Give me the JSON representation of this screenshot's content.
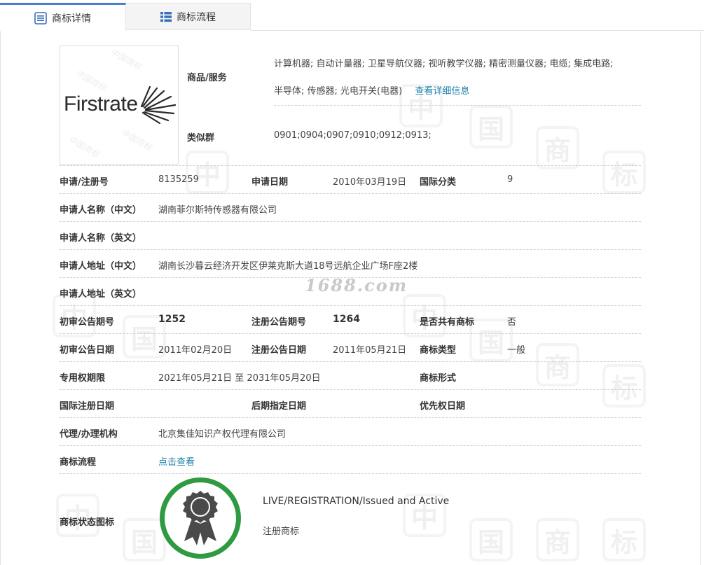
{
  "tabs": [
    {
      "label": "商标详情",
      "icon": "list-icon"
    },
    {
      "label": "商标流程",
      "icon": "grid-list-icon"
    }
  ],
  "logo": {
    "text": "Firstrate"
  },
  "watermark": {
    "char_a": "中",
    "char_b": "国",
    "char_c": "商",
    "char_d": "标",
    "site": "1688.com"
  },
  "goods": {
    "label": "商品/服务",
    "line1": "计算机器; 自动计量器; 卫星导航仪器; 视听教学仪器; 精密测量仪器; 电缆; 集成电路;",
    "line2": "半导体; 传感器; 光电开关(电器)",
    "detail_link": "查看详细信息"
  },
  "similar": {
    "label": "类似群",
    "value": "0901;0904;0907;0910;0912;0913;"
  },
  "rows": {
    "reg_no_label": "申请/注册号",
    "reg_no": "8135259",
    "apply_date_label": "申请日期",
    "apply_date": "2010年03月19日",
    "intl_class_label": "国际分类",
    "intl_class": "9",
    "applicant_cn_label": "申请人名称（中文）",
    "applicant_cn": "湖南菲尔斯特传感器有限公司",
    "applicant_en_label": "申请人名称（英文）",
    "applicant_en": "",
    "address_cn_label": "申请人地址（中文）",
    "address_cn": "湖南长沙暮云经济开发区伊莱克斯大道18号远航企业广场F座2楼",
    "address_en_label": "申请人地址（英文）",
    "address_en": "",
    "prelim_no_label": "初审公告期号",
    "prelim_no": "1252",
    "reg_pub_no_label": "注册公告期号",
    "reg_pub_no": "1264",
    "shared_label": "是否共有商标",
    "shared": "否",
    "prelim_date_label": "初审公告日期",
    "prelim_date": "2011年02月20日",
    "reg_pub_date_label": "注册公告日期",
    "reg_pub_date": "2011年05月21日",
    "type_label": "商标类型",
    "type": "一般",
    "term_label": "专用权期限",
    "term": "2021年05月21日 至 2031年05月20日",
    "form_label": "商标形式",
    "form": "",
    "intl_reg_date_label": "国际注册日期",
    "intl_reg_date": "",
    "later_date_label": "后期指定日期",
    "later_date": "",
    "priority_date_label": "优先权日期",
    "priority_date": "",
    "agent_label": "代理/办理机构",
    "agent": "北京集佳知识产权代理有限公司",
    "flow_label": "商标流程",
    "flow_link": "点击查看"
  },
  "status": {
    "label": "商标状态图标",
    "en": "LIVE/REGISTRATION/Issued and Active",
    "cn": "注册商标",
    "icon": "award-ribbon-icon",
    "ring_color": "#2e9a41"
  }
}
